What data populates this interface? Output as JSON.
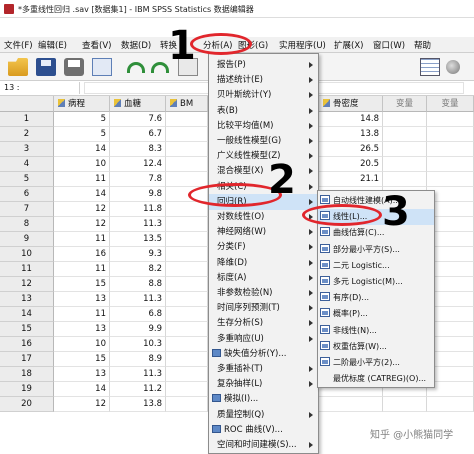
{
  "window": {
    "title": "*多重线性回归 .sav [数据集1] - IBM SPSS Statistics 数据编辑器"
  },
  "menubar": {
    "items": [
      "文件(F)",
      "编辑(E)",
      "查看(V)",
      "数据(D)",
      "转换",
      "分析(A)",
      "图形(G)",
      "实用程序(U)",
      "扩展(X)",
      "窗口(W)",
      "帮助"
    ]
  },
  "toolbar": {
    "icons": [
      "open-icon",
      "save-icon",
      "print-icon",
      "recall-dialog-icon",
      "undo-icon",
      "redo-icon",
      "goto-icon",
      "grid-icon",
      "value-labels-icon"
    ]
  },
  "cellbar": {
    "ref": "13 :"
  },
  "grid": {
    "columns": [
      "病程",
      "血糖",
      "BM",
      "骨密度",
      "变量",
      "变量"
    ],
    "rows": [
      {
        "num": "1",
        "c1": "5",
        "c2": "7.6",
        "c4": "14.8"
      },
      {
        "num": "2",
        "c1": "5",
        "c2": "6.7",
        "c4": "13.8"
      },
      {
        "num": "3",
        "c1": "14",
        "c2": "8.3",
        "c4": "26.5"
      },
      {
        "num": "4",
        "c1": "10",
        "c2": "12.4",
        "c4": "20.5"
      },
      {
        "num": "5",
        "c1": "11",
        "c2": "7.8",
        "c4": "21.1"
      },
      {
        "num": "6",
        "c1": "14",
        "c2": "9.8",
        "c4": ""
      },
      {
        "num": "7",
        "c1": "12",
        "c2": "11.8",
        "c4": ""
      },
      {
        "num": "8",
        "c1": "12",
        "c2": "11.3",
        "c4": ""
      },
      {
        "num": "9",
        "c1": "11",
        "c2": "13.5",
        "c4": ""
      },
      {
        "num": "10",
        "c1": "16",
        "c2": "9.3",
        "c4": ""
      },
      {
        "num": "11",
        "c1": "11",
        "c2": "8.2",
        "c4": ""
      },
      {
        "num": "12",
        "c1": "15",
        "c2": "8.8",
        "c4": ""
      },
      {
        "num": "13",
        "c1": "13",
        "c2": "11.3",
        "c4": ""
      },
      {
        "num": "14",
        "c1": "11",
        "c2": "6.8",
        "c4": ""
      },
      {
        "num": "15",
        "c1": "13",
        "c2": "9.9",
        "c4": ""
      },
      {
        "num": "16",
        "c1": "10",
        "c2": "10.3",
        "c4": ""
      },
      {
        "num": "17",
        "c1": "15",
        "c2": "8.9",
        "c4": ""
      },
      {
        "num": "18",
        "c1": "13",
        "c2": "11.3",
        "c4": ""
      },
      {
        "num": "19",
        "c1": "14",
        "c2": "11.2",
        "c4": ""
      },
      {
        "num": "20",
        "c1": "12",
        "c2": "13.8",
        "c4": ""
      }
    ]
  },
  "analyze_menu": {
    "items": [
      {
        "label": "报告(P)",
        "arrow": true,
        "icon": false
      },
      {
        "label": "描述统计(E)",
        "arrow": true,
        "icon": false
      },
      {
        "label": "贝叶斯统计(Y)",
        "arrow": true,
        "icon": false
      },
      {
        "label": "表(B)",
        "arrow": true,
        "icon": false
      },
      {
        "label": "比较平均值(M)",
        "arrow": true,
        "icon": false
      },
      {
        "label": "一般线性模型(G)",
        "arrow": true,
        "icon": false
      },
      {
        "label": "广义线性模型(Z)",
        "arrow": true,
        "icon": false
      },
      {
        "label": "混合模型(X)",
        "arrow": true,
        "icon": false
      },
      {
        "label": "相关(C)",
        "arrow": true,
        "icon": false
      },
      {
        "label": "回归(R)",
        "arrow": true,
        "icon": false,
        "highlight": true
      },
      {
        "label": "对数线性(O)",
        "arrow": true,
        "icon": false
      },
      {
        "label": "神经网络(W)",
        "arrow": true,
        "icon": false
      },
      {
        "label": "分类(F)",
        "arrow": true,
        "icon": false
      },
      {
        "label": "降维(D)",
        "arrow": true,
        "icon": false
      },
      {
        "label": "标度(A)",
        "arrow": true,
        "icon": false
      },
      {
        "label": "非参数检验(N)",
        "arrow": true,
        "icon": false
      },
      {
        "label": "时间序列预测(T)",
        "arrow": true,
        "icon": false
      },
      {
        "label": "生存分析(S)",
        "arrow": true,
        "icon": false
      },
      {
        "label": "多重响应(U)",
        "arrow": true,
        "icon": false
      },
      {
        "label": "缺失值分析(Y)...",
        "arrow": false,
        "icon": true
      },
      {
        "label": "多重插补(T)",
        "arrow": true,
        "icon": false
      },
      {
        "label": "复杂抽样(L)",
        "arrow": true,
        "icon": false
      },
      {
        "label": "模拟(I)...",
        "arrow": false,
        "icon": true
      },
      {
        "label": "质量控制(Q)",
        "arrow": true,
        "icon": false
      },
      {
        "label": "ROC 曲线(V)...",
        "arrow": false,
        "icon": true
      },
      {
        "label": "空间和时间建模(S)...",
        "arrow": true,
        "icon": false
      }
    ]
  },
  "regression_menu": {
    "items": [
      {
        "label": "自动线性建模(A)...",
        "icon": true
      },
      {
        "label": "线性(L)...",
        "icon": true,
        "highlight": true
      },
      {
        "label": "曲线估算(C)...",
        "icon": true
      },
      {
        "label": "部分最小平方(S)...",
        "icon": true
      },
      {
        "label": "二元 Logistic...",
        "icon": true
      },
      {
        "label": "多元 Logistic(M)...",
        "icon": true
      },
      {
        "label": "有序(D)...",
        "icon": true
      },
      {
        "label": "概率(P)...",
        "icon": true
      },
      {
        "label": "非线性(N)...",
        "icon": true
      },
      {
        "label": "权重估算(W)...",
        "icon": true
      },
      {
        "label": "二阶最小平方(2)...",
        "icon": true
      },
      {
        "label": "最优标度 (CATREG)(O)...",
        "icon": false
      }
    ]
  },
  "annotations": {
    "step1": "1",
    "step2": "2",
    "step3": "3"
  },
  "watermark": "知乎 @小熊猫同学",
  "colors": {
    "highlight": "#cfe3f7",
    "annotation_ring": "#e1262c"
  }
}
